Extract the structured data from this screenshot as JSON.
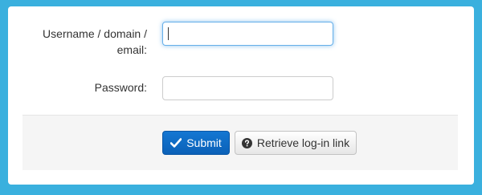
{
  "form": {
    "username_label": "Username / domain / email:",
    "password_label": "Password:",
    "username_value": "",
    "password_value": ""
  },
  "actions": {
    "submit_label": "Submit",
    "submit_icon": "check-icon",
    "retrieve_label": "Retrieve log-in link",
    "retrieve_icon": "question-circle-icon"
  },
  "colors": {
    "page_background": "#3ab0de",
    "primary_button": "#0b61b8",
    "focus_outline": "#66afe9"
  }
}
